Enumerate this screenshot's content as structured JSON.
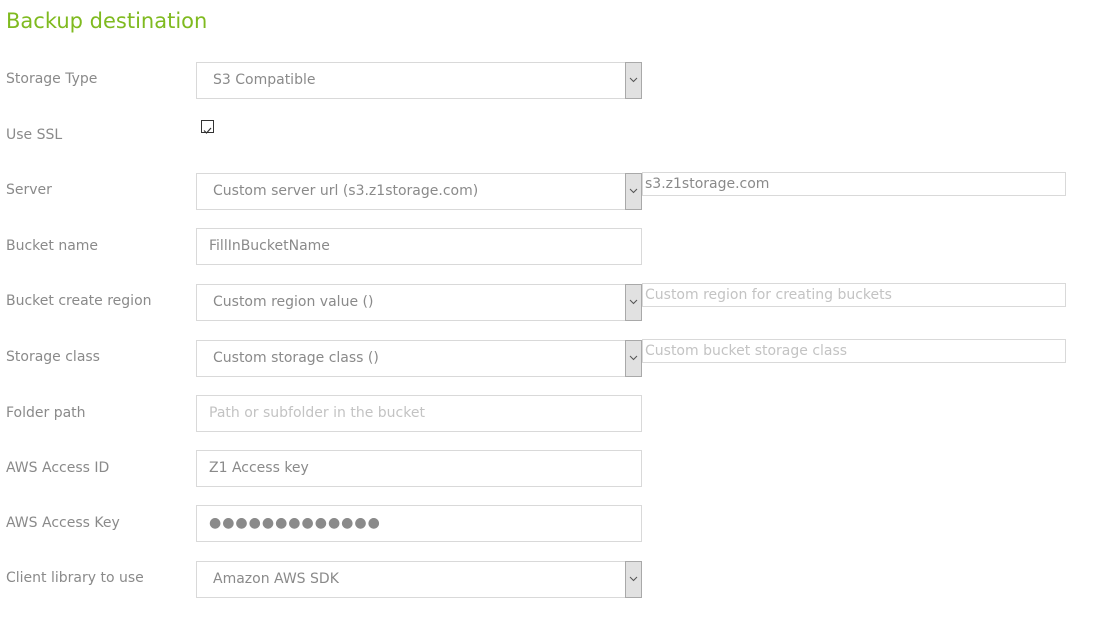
{
  "page": {
    "title": "Backup destination",
    "accent_color": "#7fba1f"
  },
  "fields": {
    "storage_type": {
      "label": "Storage Type",
      "value": "S3 Compatible"
    },
    "use_ssl": {
      "label": "Use SSL",
      "checked": true
    },
    "server": {
      "label": "Server",
      "value": "Custom server url (s3.z1storage.com)",
      "custom_value": "s3.z1storage.com"
    },
    "bucket_name": {
      "label": "Bucket name",
      "value": "FillInBucketName"
    },
    "bucket_region": {
      "label": "Bucket create region",
      "value": "Custom region value ()",
      "custom_placeholder": "Custom region for creating buckets"
    },
    "storage_class": {
      "label": "Storage class",
      "value": "Custom storage class ()",
      "custom_placeholder": "Custom bucket storage class"
    },
    "folder_path": {
      "label": "Folder path",
      "placeholder": "Path or subfolder in the bucket"
    },
    "access_id": {
      "label": "AWS Access ID",
      "value": "Z1 Access key"
    },
    "access_key": {
      "label": "AWS Access Key",
      "masked_value": "●●●●●●●●●●●●●"
    },
    "client_library": {
      "label": "Client library to use",
      "value": "Amazon AWS SDK"
    }
  }
}
